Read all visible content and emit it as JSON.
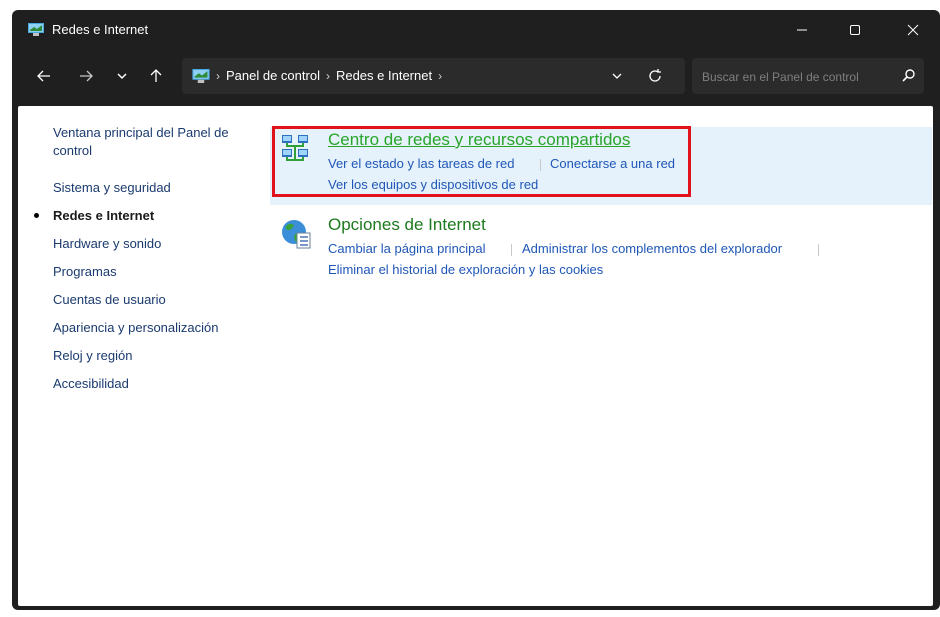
{
  "window": {
    "title": "Redes e Internet",
    "controls": {
      "minimize": "—",
      "maximize": "☐",
      "close": "✕"
    }
  },
  "nav": {
    "breadcrumb": [
      "Panel de control",
      "Redes e Internet"
    ],
    "search_placeholder": "Buscar en el Panel de control"
  },
  "sidebar": {
    "home": "Ventana principal del Panel de control",
    "items": [
      {
        "label": "Sistema y seguridad",
        "active": false
      },
      {
        "label": "Redes e Internet",
        "active": true
      },
      {
        "label": "Hardware y sonido",
        "active": false
      },
      {
        "label": "Programas",
        "active": false
      },
      {
        "label": "Cuentas de usuario",
        "active": false
      },
      {
        "label": "Apariencia y personalización",
        "active": false
      },
      {
        "label": "Reloj y región",
        "active": false
      },
      {
        "label": "Accesibilidad",
        "active": false
      }
    ]
  },
  "categories": [
    {
      "title": "Centro de redes y recursos compartidos",
      "icon": "network-center-icon",
      "highlighted": true,
      "tasks": [
        "Ver el estado y las tareas de red",
        "Conectarse a una red",
        "Ver los equipos y dispositivos de red"
      ]
    },
    {
      "title": "Opciones de Internet",
      "icon": "internet-options-icon",
      "highlighted": false,
      "tasks": [
        "Cambiar la página principal",
        "Administrar los complementos del explorador",
        "Eliminar el historial de exploración y las cookies"
      ]
    }
  ],
  "colors": {
    "highlight_border": "#e0121b",
    "link": "#1f57b8",
    "category_title": "#1e7a1e"
  }
}
